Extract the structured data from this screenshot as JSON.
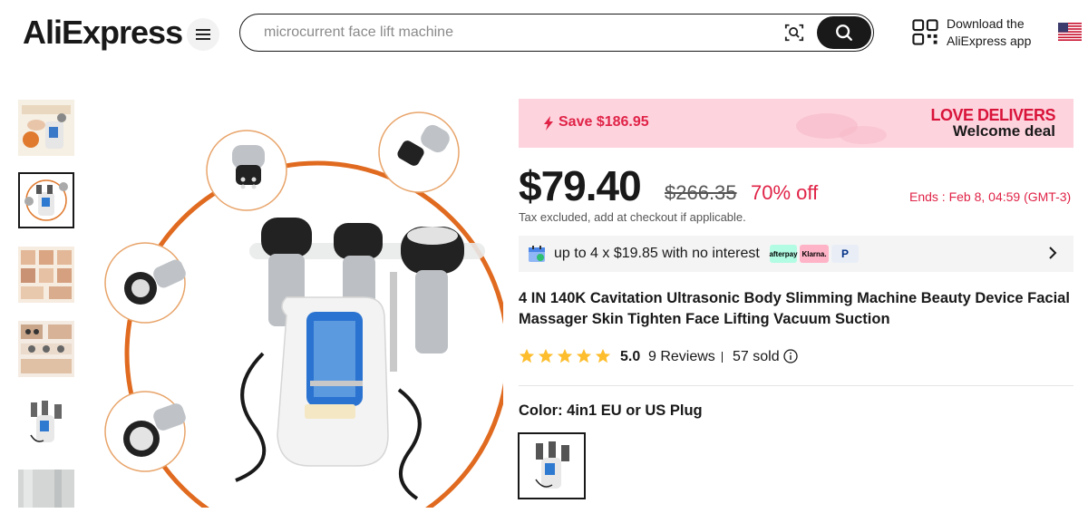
{
  "header": {
    "logo_text": "AliExpress",
    "search_value": "",
    "search_placeholder": "microcurrent face lift machine",
    "app_line1": "Download the",
    "app_line2": "AliExpress app"
  },
  "promo": {
    "save_text": "Save $186.95",
    "banner_line1": "LOVE DELIVERS",
    "banner_line2": "Welcome deal"
  },
  "pricing": {
    "price": "$79.40",
    "original_price": "$266.35",
    "discount": "70% off",
    "ends": "Ends : Feb 8, 04:59 (GMT-3)",
    "tax_note": "Tax excluded, add at checkout if applicable."
  },
  "installment": {
    "text": "up to 4 x $19.85 with no interest",
    "badges": [
      "afterpay",
      "Klarna.",
      "P"
    ]
  },
  "product": {
    "title": "4 IN 140K Cavitation Ultrasonic Body Slimming Machine Beauty Device Facial Massager Skin Tighten Face Lifting Vacuum Suction",
    "rating": "5.0",
    "reviews": "9 Reviews",
    "sold": "57 sold",
    "color_label": "Color: 4in1 EU or US Plug"
  },
  "colors": {
    "accent": "#e02347",
    "promo_bg": "#fdd3de",
    "star": "#fdbd2c",
    "text": "#191919"
  },
  "icons": [
    "menu-icon",
    "scan-icon",
    "search-icon",
    "qr-code-icon",
    "us-flag-icon",
    "bolt-icon",
    "calendar-icon",
    "chevron-right-icon",
    "star-icon",
    "info-icon"
  ]
}
